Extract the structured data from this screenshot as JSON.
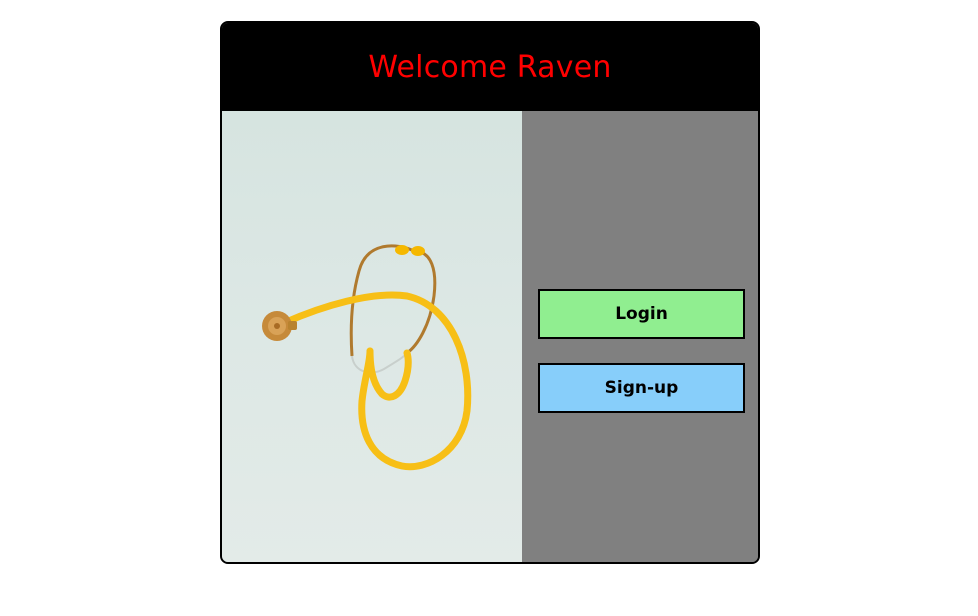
{
  "header": {
    "title": "Welcome Raven"
  },
  "hero_image": {
    "subject": "stethoscope-image"
  },
  "actions": {
    "login_label": "Login",
    "signup_label": "Sign-up"
  },
  "colors": {
    "title": "#ff0000",
    "header_bg": "#000000",
    "panel_bg": "#808080",
    "login_bg": "#90ee90",
    "signup_bg": "#87cefa"
  }
}
